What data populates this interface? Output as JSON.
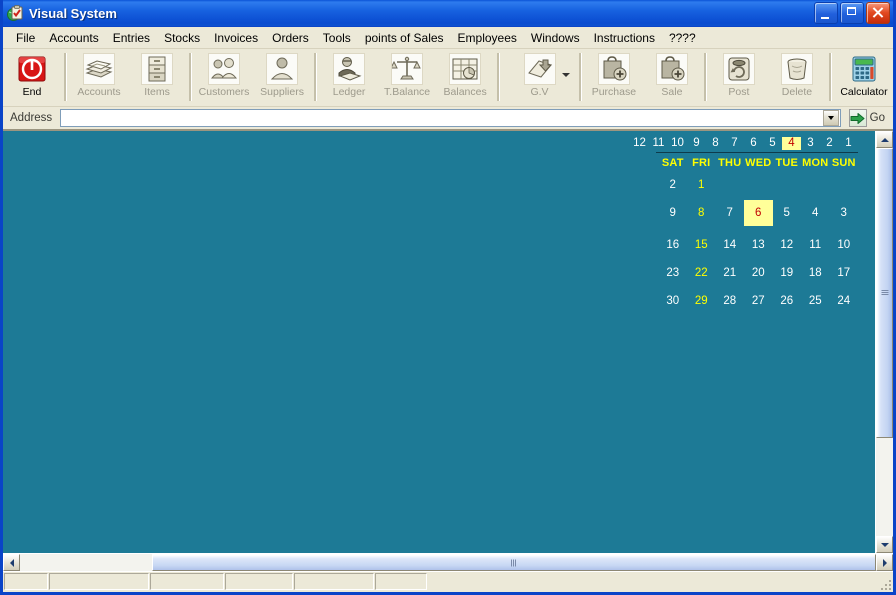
{
  "window": {
    "title": "Visual System",
    "icon": "clipboard-check-globe-icon",
    "minimize_label": "Minimize",
    "maximize_label": "Maximize",
    "close_label": "Close"
  },
  "menubar": {
    "items": [
      {
        "label": "File"
      },
      {
        "label": "Accounts"
      },
      {
        "label": "Entries"
      },
      {
        "label": "Stocks"
      },
      {
        "label": "Invoices"
      },
      {
        "label": "Orders"
      },
      {
        "label": "Tools"
      },
      {
        "label": "points of Sales"
      },
      {
        "label": "Employees"
      },
      {
        "label": "Windows"
      },
      {
        "label": "Instructions"
      },
      {
        "label": "????"
      }
    ]
  },
  "toolbar": {
    "groups": [
      {
        "buttons": [
          {
            "label": "End",
            "icon": "power-stop-icon",
            "enabled": true
          }
        ]
      },
      {
        "buttons": [
          {
            "label": "Accounts",
            "icon": "books-icon",
            "enabled": false
          },
          {
            "label": "Items",
            "icon": "filing-cabinet-icon",
            "enabled": false
          }
        ]
      },
      {
        "buttons": [
          {
            "label": "Customers",
            "icon": "people-group-icon",
            "enabled": false
          },
          {
            "label": "Suppliers",
            "icon": "person-icon",
            "enabled": false
          }
        ]
      },
      {
        "buttons": [
          {
            "label": "Ledger",
            "icon": "clerk-book-icon",
            "enabled": false
          },
          {
            "label": "T.Balance",
            "icon": "scales-icon",
            "enabled": false
          },
          {
            "label": "Balances",
            "icon": "spreadsheet-icon",
            "enabled": false
          }
        ]
      },
      {
        "buttons": [
          {
            "label": "G.V",
            "icon": "voucher-down-arrow-icon",
            "enabled": false,
            "has_menu": true
          }
        ]
      },
      {
        "buttons": [
          {
            "label": "Purchase",
            "icon": "bag-plus-icon",
            "enabled": false
          },
          {
            "label": "Sale",
            "icon": "bag-plus-icon",
            "enabled": false
          }
        ]
      },
      {
        "buttons": [
          {
            "label": "Post",
            "icon": "post-refresh-icon",
            "enabled": false
          },
          {
            "label": "Delete",
            "icon": "trash-bin-icon",
            "enabled": false
          }
        ]
      },
      {
        "buttons": [
          {
            "label": "Calculator",
            "icon": "calculator-icon",
            "enabled": true
          }
        ]
      }
    ]
  },
  "addressbar": {
    "label": "Address",
    "value": "",
    "placeholder": "",
    "dropdown_icon": "chevron-down-icon",
    "go_label": "Go",
    "go_icon": "green-arrow-right-icon"
  },
  "calendar": {
    "months": [
      "12",
      "11",
      "10",
      "9",
      "8",
      "7",
      "6",
      "5",
      "4",
      "3",
      "2",
      "1"
    ],
    "selected_month": "4",
    "day_headers": [
      "SAT",
      "FRI",
      "THU",
      "WED",
      "TUE",
      "MON",
      "SUN"
    ],
    "weeks": [
      [
        "2",
        "1",
        "",
        "",
        "",
        "",
        ""
      ],
      [
        "9",
        "8",
        "7",
        "6",
        "5",
        "4",
        "3"
      ],
      [
        "16",
        "15",
        "14",
        "13",
        "12",
        "11",
        "10"
      ],
      [
        "23",
        "22",
        "21",
        "20",
        "19",
        "18",
        "17"
      ],
      [
        "30",
        "29",
        "28",
        "27",
        "26",
        "25",
        "24"
      ]
    ],
    "selected_day": "6",
    "highlight_column_index": 1,
    "colors": {
      "background": "#1D7A96",
      "day_header": "#FFFF00",
      "highlight_bg": "#FFFF99",
      "highlight_fg": "#C00000",
      "day_text": "#FFFFFF"
    }
  },
  "scrollbars": {
    "vertical": {
      "up_icon": "chevron-up-icon",
      "down_icon": "chevron-down-icon"
    },
    "horizontal": {
      "left_icon": "chevron-left-icon",
      "right_icon": "chevron-right-icon"
    }
  },
  "statusbar": {
    "panels": [
      "",
      "",
      "",
      "",
      "",
      ""
    ]
  },
  "theme": {
    "workspace": "#1D7A96",
    "chrome": "#ECE9D8",
    "titlebar": "#1762E0",
    "window_border": "#0A44C8"
  }
}
